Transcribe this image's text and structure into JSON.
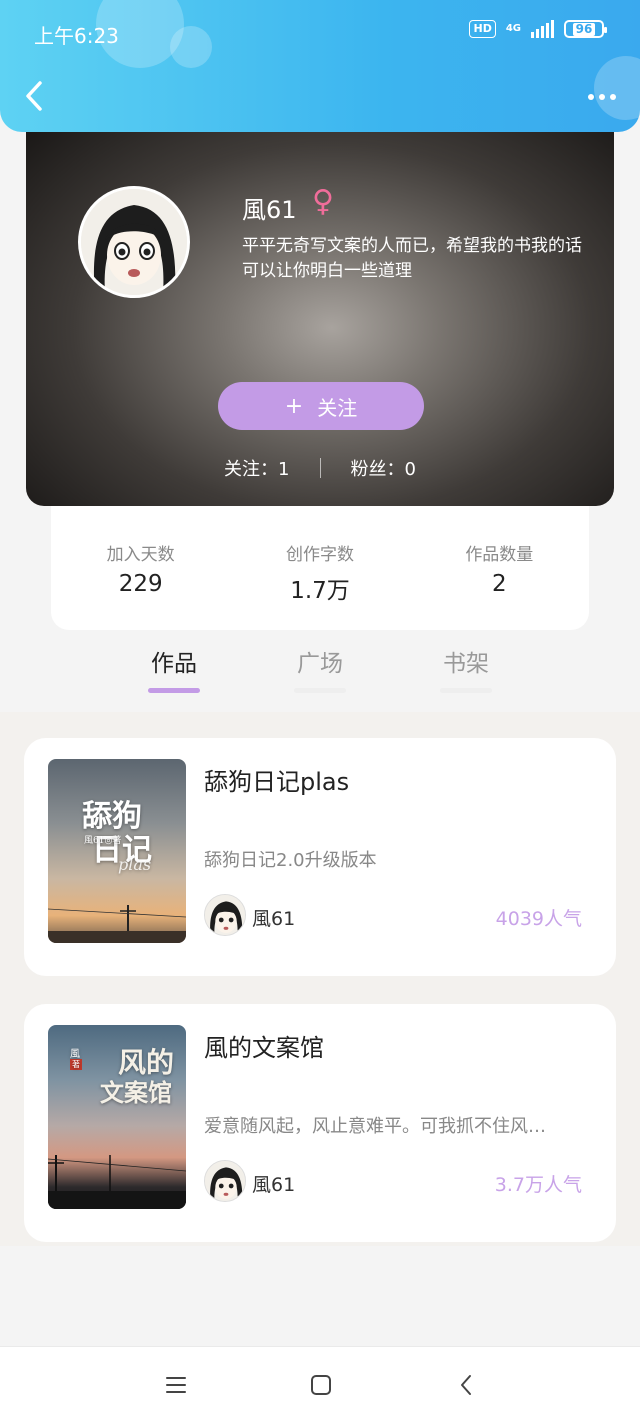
{
  "status_bar": {
    "time": "上午6:23",
    "hd": "HD",
    "network": "4G",
    "battery": "96"
  },
  "header": {
    "back_icon": "chevron-left-icon",
    "more_icon": "more-dots-icon"
  },
  "profile": {
    "name": "風61",
    "gender_symbol": "♀",
    "bio": "平平无奇写文案的人而已，希望我的书我的话可以让你明白一些道理",
    "follow_label": "关注",
    "follow_plus": "+",
    "following": "关注：1",
    "followers": "粉丝：0"
  },
  "stats": [
    {
      "label": "加入天数",
      "value": "229"
    },
    {
      "label": "创作字数",
      "value": "1.7万"
    },
    {
      "label": "作品数量",
      "value": "2"
    }
  ],
  "tabs": [
    {
      "label": "作品",
      "active": true
    },
    {
      "label": "广场",
      "active": false
    },
    {
      "label": "书架",
      "active": false
    }
  ],
  "books": [
    {
      "title": "舔狗日记plas",
      "description": "舔狗日记2.0升级版本",
      "author": "風61",
      "popularity": "4039人气",
      "cover_text_1": "舔狗",
      "cover_text_2": "日记",
      "cover_sub": "風61◎著",
      "cover_script": "plas"
    },
    {
      "title": "風的文案馆",
      "description": "爱意随风起，风止意难平。可我抓不住风…",
      "author": "風61",
      "popularity": "3.7万人气",
      "cover_text_1": "风的",
      "cover_text_2": "文案馆",
      "cover_sub": "風",
      "cover_script": "著"
    }
  ],
  "colors": {
    "accent": "#c39be6",
    "header": "#3cb5ef",
    "gender": "#f06d9a",
    "popularity": "#c8a3e8"
  }
}
